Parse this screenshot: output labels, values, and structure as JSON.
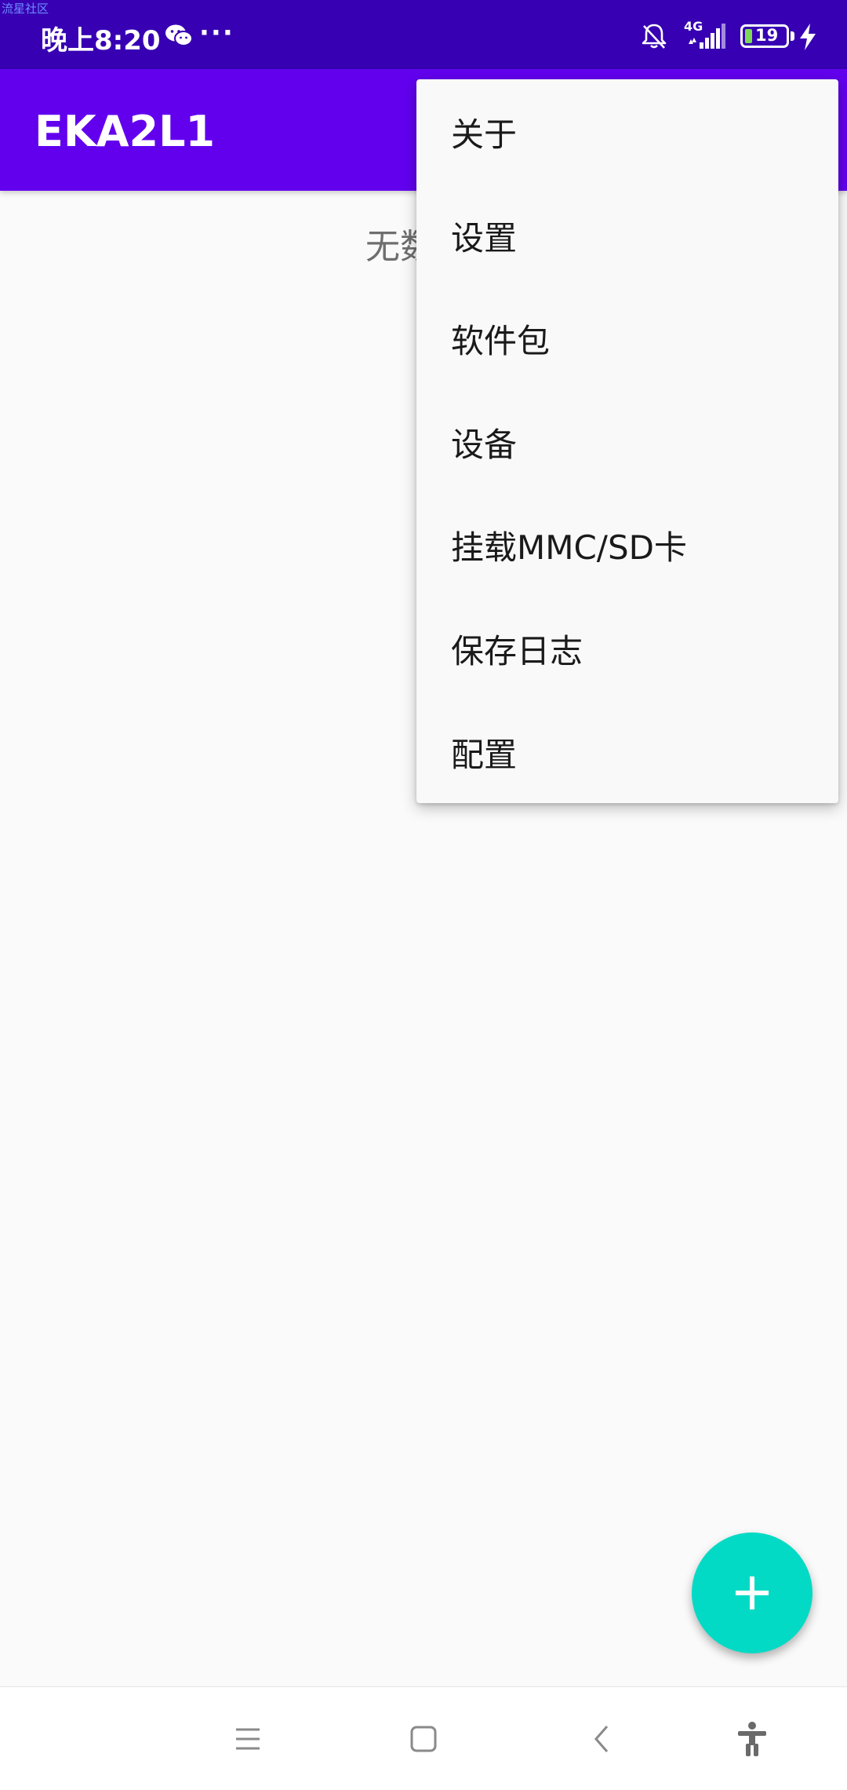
{
  "watermark": "流星社区",
  "status_bar": {
    "time": "晚上8:20",
    "more": "···",
    "network": "4G",
    "battery_level": "19",
    "icons": [
      "wechat-icon",
      "bell-off-icon",
      "signal-icon",
      "battery-icon",
      "charging-bolt-icon"
    ]
  },
  "app_bar": {
    "title": "EKA2L1"
  },
  "main": {
    "empty_text": "无数"
  },
  "overflow_menu": {
    "items": [
      {
        "label": "关于"
      },
      {
        "label": "设置"
      },
      {
        "label": "软件包"
      },
      {
        "label": "设备"
      },
      {
        "label": "挂载MMC/SD卡"
      },
      {
        "label": "保存日志"
      },
      {
        "label": "配置"
      }
    ]
  },
  "fab": {
    "icon": "plus-icon"
  },
  "nav_bar": {
    "icons": [
      "menu-icon",
      "home-square-icon",
      "back-chevron-icon",
      "accessibility-icon"
    ]
  },
  "colors": {
    "status_bar": "#3700b3",
    "app_bar": "#6200ee",
    "fab": "#03dac5",
    "menu_bg": "#f9f9f9"
  }
}
